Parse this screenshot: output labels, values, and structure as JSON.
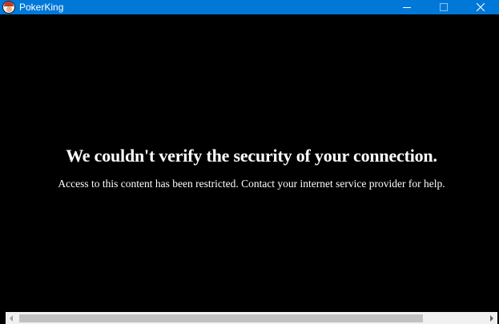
{
  "window": {
    "title": "PokerKing",
    "icon": "pokerking-app-icon"
  },
  "caption_buttons": {
    "minimize_icon": "minimize-icon",
    "maximize_icon": "maximize-icon",
    "close_icon": "close-icon"
  },
  "content": {
    "headline": "We couldn't verify the security of your connection.",
    "message": "Access to this content has been restricted. Contact your internet service provider for help."
  },
  "scrollbar": {
    "left_arrow_icon": "scroll-left-arrow-icon",
    "right_arrow_icon": "scroll-right-arrow-icon"
  },
  "colors": {
    "titlebar": "#0078d7",
    "background": "#000000",
    "text": "#ffffff",
    "scrollbar_track": "#f0f0f0",
    "scrollbar_thumb": "#c1c1c1"
  }
}
